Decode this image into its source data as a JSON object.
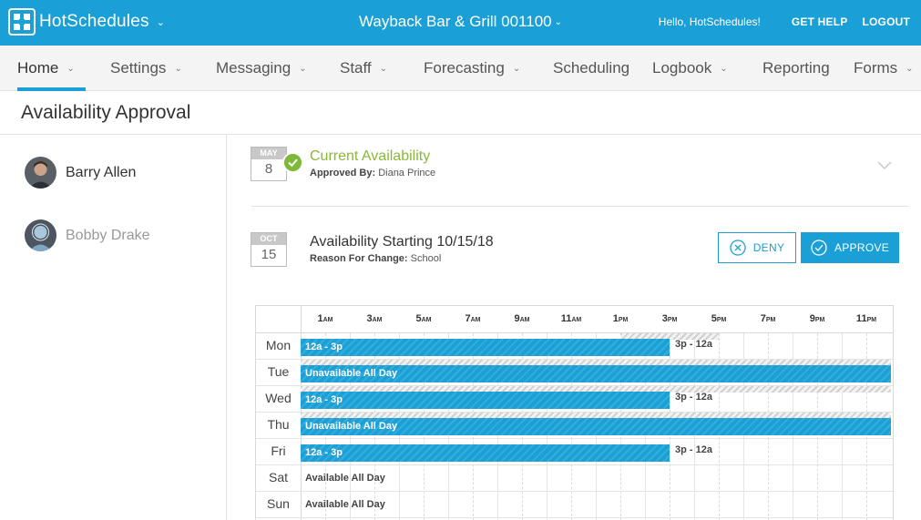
{
  "header": {
    "app_name": "HotSchedules",
    "store_name": "Wayback Bar & Grill 001100",
    "greeting": "Hello, HotSchedules!",
    "get_help": "GET HELP",
    "logout": "LOGOUT",
    "brand_color": "#1aa0d6"
  },
  "nav": {
    "items": [
      {
        "label": "Home",
        "has_dropdown": true,
        "active": true
      },
      {
        "label": "Settings",
        "has_dropdown": true
      },
      {
        "label": "Messaging",
        "has_dropdown": true
      },
      {
        "label": "Staff",
        "has_dropdown": true
      },
      {
        "label": "Forecasting",
        "has_dropdown": true
      },
      {
        "label": "Scheduling",
        "has_dropdown": false
      },
      {
        "label": "Logbook",
        "has_dropdown": true
      },
      {
        "label": "Reporting",
        "has_dropdown": false
      },
      {
        "label": "Forms",
        "has_dropdown": true
      }
    ]
  },
  "page": {
    "title": "Availability Approval"
  },
  "employees": [
    {
      "name": "Barry Allen",
      "selected": true
    },
    {
      "name": "Bobby Drake",
      "selected": false
    }
  ],
  "current": {
    "month": "MAY",
    "day": "8",
    "title": "Current Availability",
    "approved_by_label": "Approved By:",
    "approved_by": "Diana Prince",
    "status_color": "#8ab83a"
  },
  "request": {
    "month": "OCT",
    "day": "15",
    "title": "Availability Starting 10/15/18",
    "reason_label": "Reason For Change:",
    "reason": "School",
    "deny_label": "DENY",
    "approve_label": "APPROVE"
  },
  "grid": {
    "time_labels": [
      {
        "num": "1",
        "ampm": "AM"
      },
      {
        "num": "3",
        "ampm": "AM"
      },
      {
        "num": "5",
        "ampm": "AM"
      },
      {
        "num": "7",
        "ampm": "AM"
      },
      {
        "num": "9",
        "ampm": "AM"
      },
      {
        "num": "11",
        "ampm": "AM"
      },
      {
        "num": "1",
        "ampm": "PM"
      },
      {
        "num": "3",
        "ampm": "PM"
      },
      {
        "num": "5",
        "ampm": "PM"
      },
      {
        "num": "7",
        "ampm": "PM"
      },
      {
        "num": "9",
        "ampm": "PM"
      },
      {
        "num": "11",
        "ampm": "PM"
      }
    ],
    "days": [
      {
        "day": "Mon",
        "proposed": {
          "label": "12a - 3p",
          "start": 0,
          "end": 15
        },
        "current_label": "3p - 12a",
        "current_unavail": {
          "start": 13,
          "end": 17
        }
      },
      {
        "day": "Tue",
        "proposed": {
          "label": "Unavailable All Day",
          "start": 0,
          "end": 24
        },
        "current_unavail": {
          "start": 0,
          "end": 24
        }
      },
      {
        "day": "Wed",
        "proposed": {
          "label": "12a - 3p",
          "start": 0,
          "end": 15
        },
        "current_label": "3p - 12a",
        "current_unavail": {
          "start": 0,
          "end": 24
        }
      },
      {
        "day": "Thu",
        "proposed": {
          "label": "Unavailable All Day",
          "start": 0,
          "end": 24
        },
        "current_unavail": {
          "start": 0,
          "end": 24
        }
      },
      {
        "day": "Fri",
        "proposed": {
          "label": "12a - 3p",
          "start": 0,
          "end": 15
        },
        "current_label": "3p - 12a"
      },
      {
        "day": "Sat",
        "available_label": "Available All Day"
      },
      {
        "day": "Sun",
        "available_label": "Available All Day"
      }
    ]
  }
}
